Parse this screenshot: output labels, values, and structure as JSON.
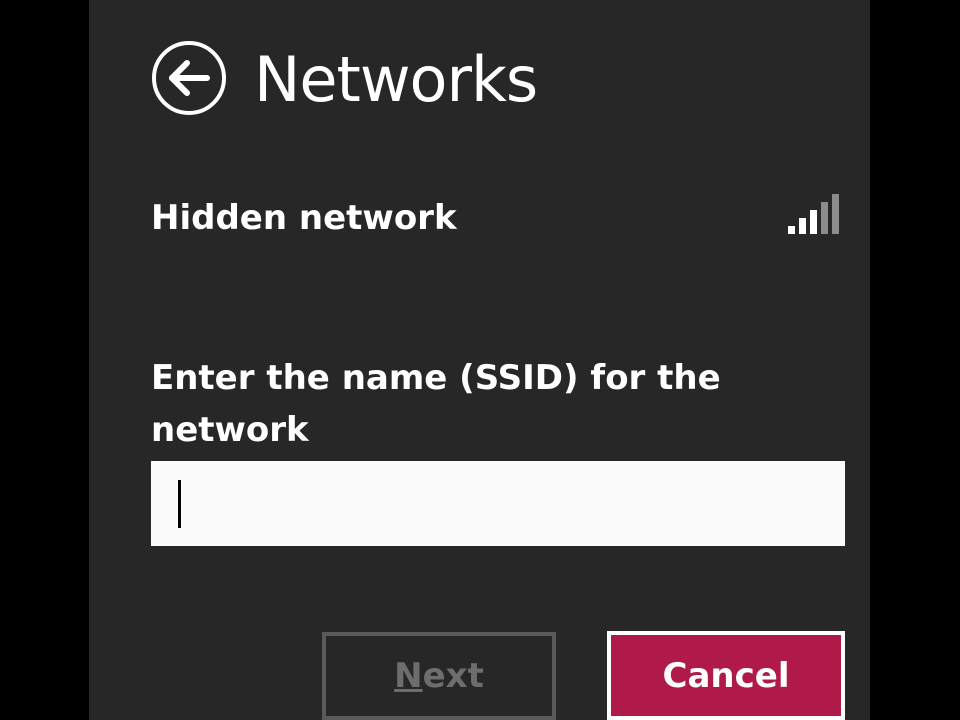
{
  "header": {
    "title": "Networks",
    "back_icon": "back-arrow-icon"
  },
  "network": {
    "name": "Hidden network",
    "signal_icon": "wifi-signal-strength-icon",
    "signal_bars_total": 5,
    "signal_bars_full": 3
  },
  "ssid_form": {
    "label": "Enter the name (SSID) for the network",
    "input_value": ""
  },
  "buttons": {
    "next_mnemonic": "N",
    "next_rest": "ext",
    "cancel_label": "Cancel"
  },
  "colors": {
    "panel_background": "#272727",
    "outer_background": "#000000",
    "cancel_button": "#b01a48",
    "disabled_text": "#6d6d6d"
  }
}
